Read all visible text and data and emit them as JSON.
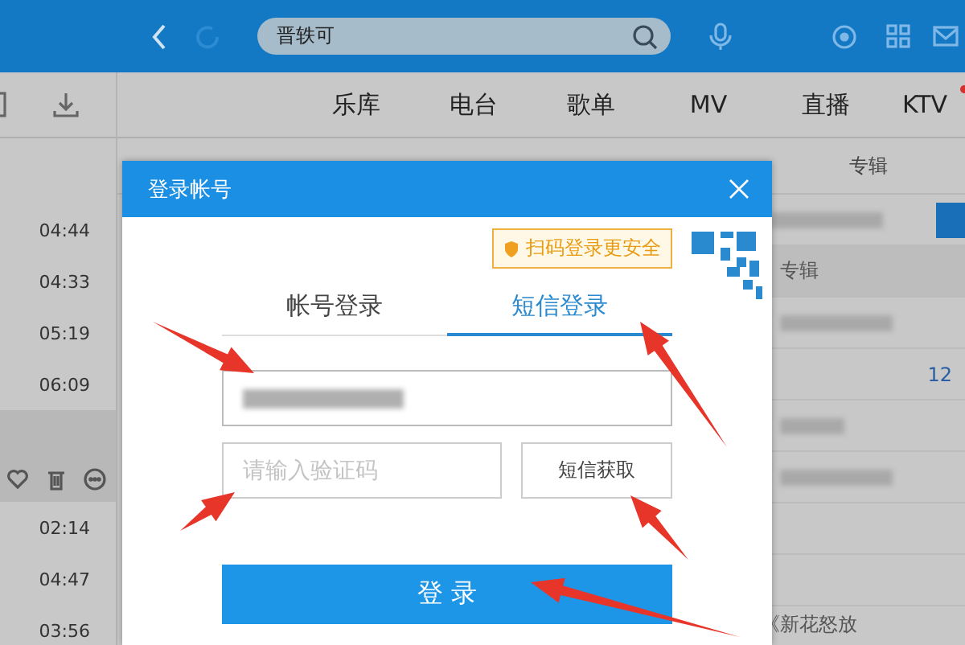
{
  "topbar": {
    "search": {
      "value": "晋轶可"
    }
  },
  "nav": {
    "tabs": [
      {
        "label": "乐库",
        "selected": false,
        "dot": false
      },
      {
        "label": "电台",
        "selected": false,
        "dot": false
      },
      {
        "label": "歌单",
        "selected": false,
        "dot": false
      },
      {
        "label": "MV",
        "selected": false,
        "dot": false
      },
      {
        "label": "直播",
        "selected": false,
        "dot": false
      },
      {
        "label": "KTV",
        "selected": false,
        "dot": true
      }
    ],
    "sub_tab": "专辑"
  },
  "sidebar": {
    "rows": [
      {
        "duration": "04:44",
        "selected": false
      },
      {
        "duration": "04:33",
        "selected": false
      },
      {
        "duration": "05:19",
        "selected": false
      },
      {
        "duration": "06:09",
        "selected": false
      },
      {
        "selected": true
      },
      {
        "duration": "02:14",
        "selected": false
      },
      {
        "duration": "04:47",
        "selected": false
      },
      {
        "duration": "03:56",
        "selected": false
      }
    ]
  },
  "right_column": {
    "header": "专辑",
    "count": "12",
    "bottom": "《新花怒放"
  },
  "dialog": {
    "title": "登录帐号",
    "qr_hint": "扫码登录更安全",
    "tabs": [
      {
        "label": "帐号登录",
        "selected": false
      },
      {
        "label": "短信登录",
        "selected": true
      }
    ],
    "code_field": {
      "placeholder": "请输入验证码"
    },
    "sms_button": "短信获取",
    "login_button": "登 录"
  }
}
